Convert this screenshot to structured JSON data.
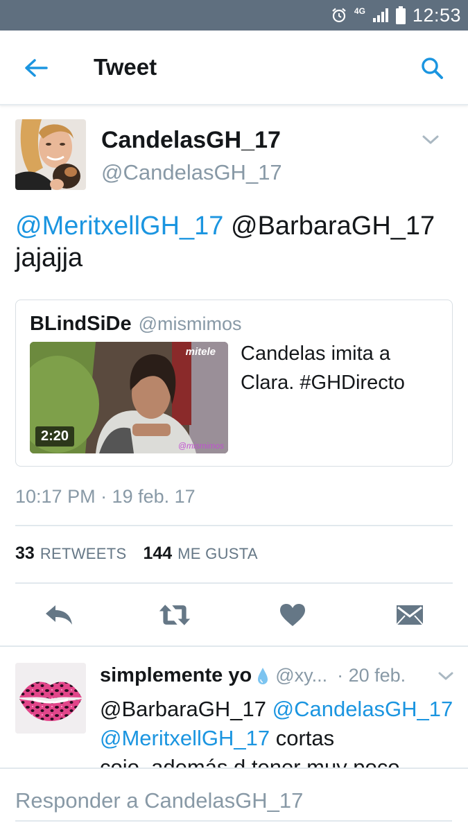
{
  "status_bar": {
    "network": "4G",
    "time": "12:53"
  },
  "header": {
    "title": "Tweet"
  },
  "tweet": {
    "author_name": "CandelasGH_17",
    "author_handle": "@CandelasGH_17",
    "text_mentions": [
      "@MeritxellGH_17",
      "@BarbaraGH_17"
    ],
    "text_body": "jajajja",
    "quoted": {
      "author_name": "BLindSiDe",
      "author_handle": "@mismimos",
      "text": "Candelas imita a Clara. #GHDirecto",
      "media_duration": "2:20",
      "media_brand": "mitele",
      "media_watermark": "@mismimos"
    },
    "timestamp": "10:17 PM · 19 feb. 17",
    "retweets_count": "33",
    "retweets_label": "RETWEETS",
    "likes_count": "144",
    "likes_label": "ME GUSTA"
  },
  "actions": [
    "reply-icon",
    "retweet-icon",
    "heart-icon",
    "dm-icon"
  ],
  "reply": {
    "author_name": "simplemente yo",
    "author_handle": "@xy...",
    "time": "· 20 feb.",
    "mention_1": "@BarbaraGH_17",
    "mention_2": "@CandelasGH_17",
    "mention_3": "@MeritxellGH_17",
    "text_1": "cortas",
    "text_2": "cojo, además d tener muy poco"
  },
  "composer": {
    "placeholder": "Responder a CandelasGH_17"
  },
  "colors": {
    "accent": "#1b95e0",
    "status_bar": "#5f6f7f",
    "muted_text": "#8899a6",
    "icon_gray": "#657786"
  }
}
